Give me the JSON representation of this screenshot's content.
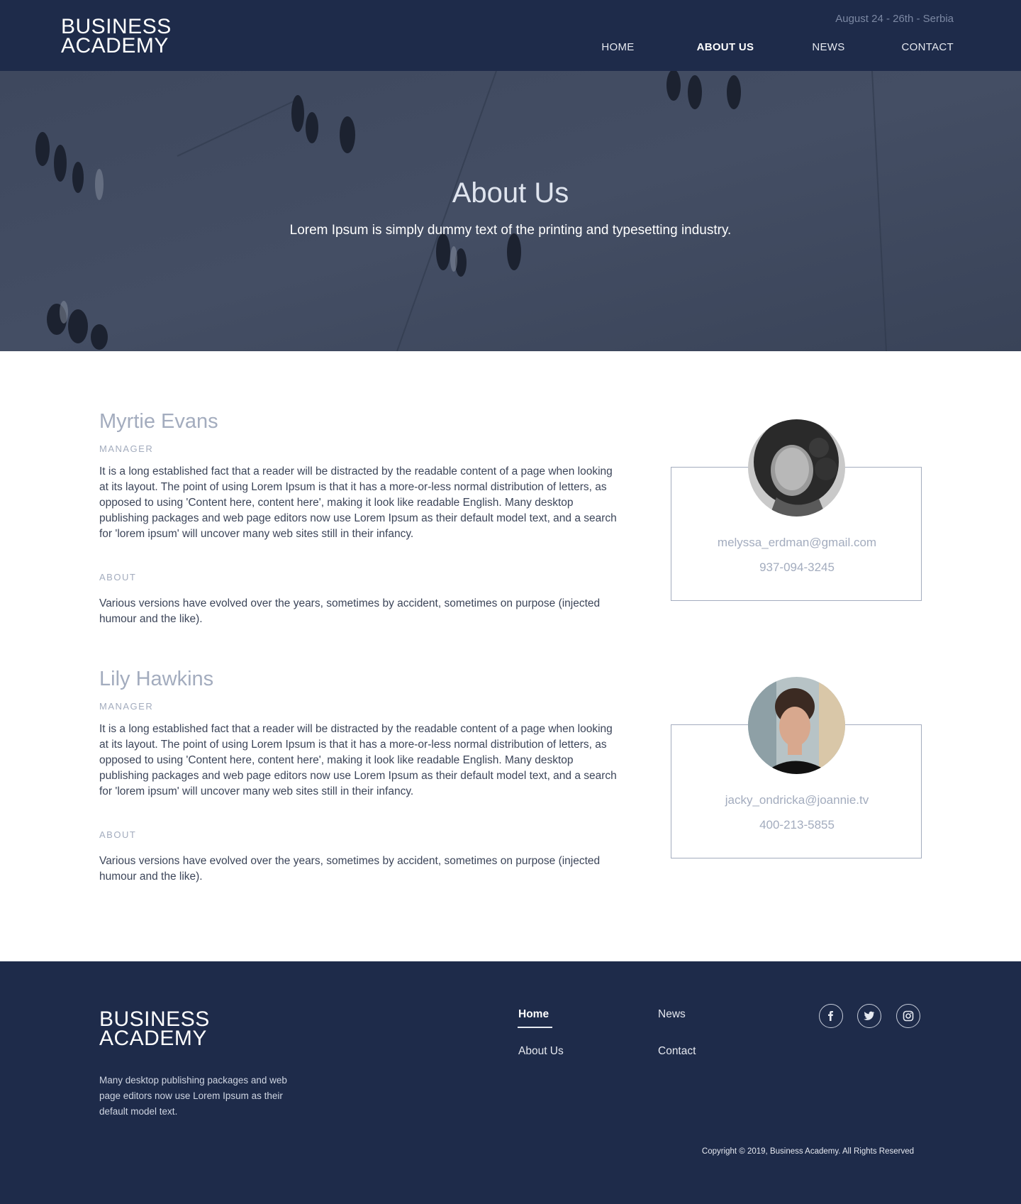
{
  "header": {
    "logo_line1": "BUSINESS",
    "logo_line2": "ACADEMY",
    "event_date": "August 24 - 26th - Serbia",
    "nav": [
      {
        "label": "HOME",
        "active": false
      },
      {
        "label": "ABOUT US",
        "active": true
      },
      {
        "label": "NEWS",
        "active": false
      },
      {
        "label": "CONTACT",
        "active": false
      }
    ]
  },
  "hero": {
    "title": "About Us",
    "subtitle": "Lorem Ipsum is simply dummy text of the printing and typesetting industry."
  },
  "members": [
    {
      "name": "Myrtie Evans",
      "role": "MANAGER",
      "bio": "It is a long established fact that a reader will be distracted by the readable content of a page when looking at its layout. The point of using Lorem Ipsum is that it has a more-or-less normal distribution of letters, as opposed to using 'Content here, content here', making it look like readable English. Many desktop publishing packages and web page editors now use Lorem Ipsum as their default model text, and a search for 'lorem ipsum' will uncover many web sites still in their infancy.",
      "about_label": "ABOUT",
      "about": "Various versions have evolved over the years, sometimes by accident, sometimes on purpose (injected humour and the like).",
      "email": "melyssa_erdman@gmail.com",
      "phone": "937-094-3245"
    },
    {
      "name": "Lily Hawkins",
      "role": "MANAGER",
      "bio": "It is a long established fact that a reader will be distracted by the readable content of a page when looking at its layout. The point of using Lorem Ipsum is that it has a more-or-less normal distribution of letters, as opposed to using 'Content here, content here', making it look like readable English. Many desktop publishing packages and web page editors now use Lorem Ipsum as their default model text, and a search for 'lorem ipsum' will uncover many web sites still in their infancy.",
      "about_label": "ABOUT",
      "about": "Various versions have evolved over the years, sometimes by accident, sometimes on purpose (injected humour and the like).",
      "email": "jacky_ondricka@joannie.tv",
      "phone": "400-213-5855"
    }
  ],
  "footer": {
    "logo_line1": "BUSINESS",
    "logo_line2": "ACADEMY",
    "text": "Many desktop publishing packages and web page editors now use Lorem Ipsum as their default model text.",
    "links": [
      {
        "label": "Home",
        "active": true
      },
      {
        "label": "News",
        "active": false
      },
      {
        "label": "About Us",
        "active": false
      },
      {
        "label": "Contact",
        "active": false
      }
    ],
    "social": [
      "facebook-icon",
      "twitter-icon",
      "instagram-icon"
    ],
    "copyright": "Copyright © 2019, Business Academy. All Rights Reserved"
  },
  "colors": {
    "navy": "#1e2b4a",
    "muted": "#a3acbe",
    "text": "#3c4559"
  }
}
